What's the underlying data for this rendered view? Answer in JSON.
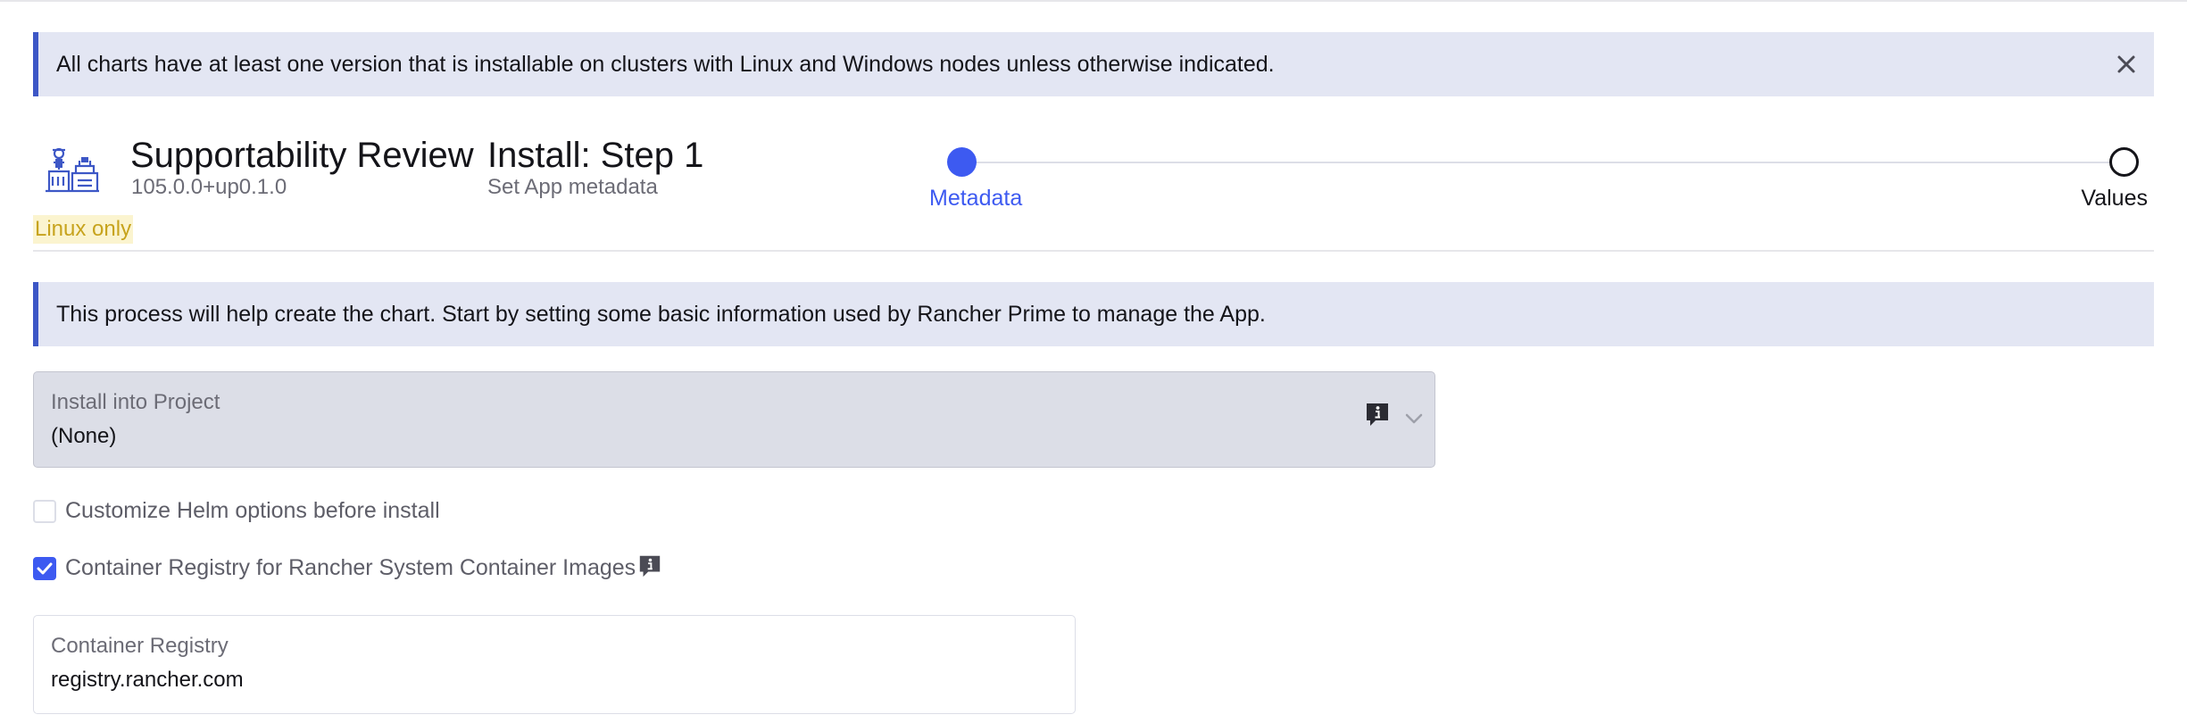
{
  "banners": {
    "top": "All charts have at least one version that is installable on clusters with Linux and Windows nodes unless otherwise indicated.",
    "info": "This process will help create the chart. Start by setting some basic information used by Rancher Prime to manage the App."
  },
  "chart": {
    "name": "Supportability Review",
    "version": "105.0.0+up0.1.0",
    "os_badge": "Linux only"
  },
  "step": {
    "title": "Install: Step 1",
    "subtitle": "Set App metadata"
  },
  "stepper": {
    "steps": [
      {
        "label": "Metadata",
        "active": true
      },
      {
        "label": "Values",
        "active": false
      }
    ]
  },
  "form": {
    "project_select": {
      "label": "Install into Project",
      "value": "(None)"
    },
    "customize_helm": {
      "label": "Customize Helm options before install",
      "checked": false
    },
    "container_registry_toggle": {
      "label": "Container Registry for Rancher System Container Images",
      "checked": true
    },
    "registry_field": {
      "label": "Container Registry",
      "value": "registry.rancher.com"
    }
  },
  "colors": {
    "accent": "#3d5af1",
    "banner_bg": "#e3e6f3",
    "banner_border": "#3d57c6",
    "badge_bg": "#fbf4cf",
    "badge_text": "#c7a31d"
  },
  "icons": {
    "close": "close-icon",
    "info": "info-icon",
    "chevron": "chevron-down-icon",
    "logo": "chart-logo-icon"
  }
}
